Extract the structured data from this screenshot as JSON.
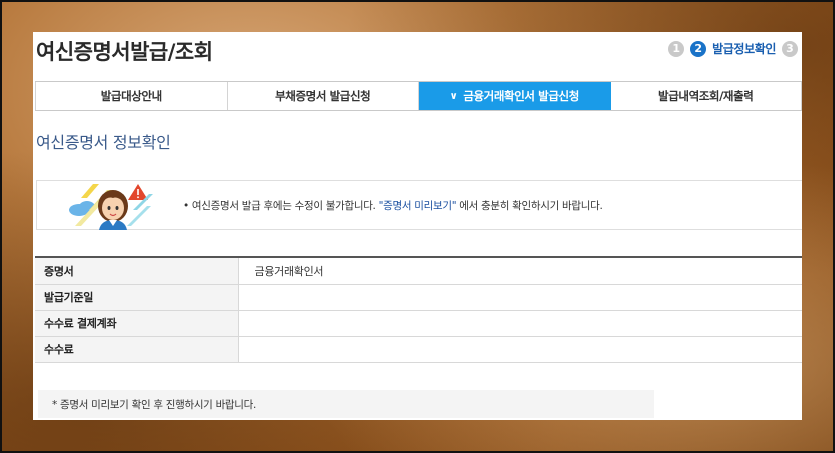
{
  "page": {
    "title": "여신증명서발급/조회",
    "section_title": "여신증명서 정보확인"
  },
  "steps": [
    {
      "number": "1",
      "label": "",
      "active": false
    },
    {
      "number": "2",
      "label": "발급정보확인",
      "active": true
    },
    {
      "number": "3",
      "label": "",
      "active": false
    }
  ],
  "tabs": [
    {
      "label": "발급대상안내",
      "active": false
    },
    {
      "label": "부채증명서 발급신청",
      "active": false
    },
    {
      "label": "금융거래확인서 발급신청",
      "active": true,
      "icon": "chevron-down-icon"
    },
    {
      "label": "발급내역조회/재출력",
      "active": false
    }
  ],
  "notice": {
    "prefix": "• 여신증명서 발급 후에는 수정이 불가합니다. ",
    "highlight": "\"증명서 미리보기\"",
    "suffix": " 에서 충분히 확인하시기 바랍니다."
  },
  "info_table": {
    "rows": [
      {
        "label": "증명서",
        "value": "금융거래확인서"
      },
      {
        "label": "발급기준일",
        "value": ""
      },
      {
        "label": "수수료 결제계좌",
        "value": ""
      },
      {
        "label": "수수료",
        "value": ""
      }
    ]
  },
  "footer_note": "* 증명서 미리보기 확인 후 진행하시기 바랍니다.",
  "colors": {
    "accent": "#1a9be8",
    "step_active": "#1a73c8",
    "step_inactive": "#c9c9c9",
    "section_title": "#3a5a8a"
  }
}
